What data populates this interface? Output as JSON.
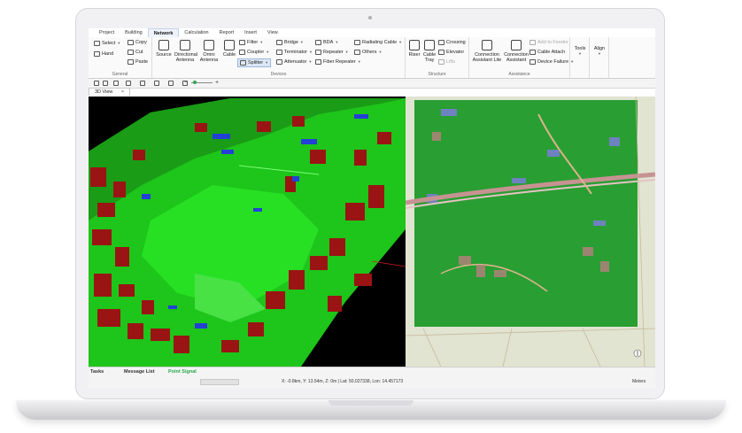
{
  "menu": {
    "tabs": [
      {
        "label": "Project"
      },
      {
        "label": "Building"
      },
      {
        "label": "Network"
      },
      {
        "label": "Calculation"
      },
      {
        "label": "Report"
      },
      {
        "label": "Insert"
      },
      {
        "label": "View"
      }
    ],
    "active_tab": "Network"
  },
  "ribbon": {
    "general": {
      "label": "General",
      "select": "Select",
      "hand": "Hand",
      "copy": "Copy",
      "cut": "Cut",
      "paste": "Paste"
    },
    "devices": {
      "label": "Devices",
      "source": "Source",
      "directional_antenna": "Directional Antenna",
      "omni_antenna": "Omni Antenna",
      "cable": "Cable",
      "filter": "Filter",
      "coupler": "Coupler",
      "splitter": "Splitter",
      "bridge": "Bridge",
      "terminator": "Terminator",
      "attenuator": "Attenuator",
      "bda": "BDA",
      "repeater": "Repeater",
      "fiber_repeater": "Fiber Repeater",
      "radiating_cable": "Radiating Cable",
      "others": "Others"
    },
    "structure": {
      "label": "Structure",
      "riser": "Riser",
      "cable_tray": "Cable Tray",
      "crossing": "Crossing",
      "elevator": "Elevator",
      "lifts": "Lifts"
    },
    "assistance": {
      "label": "Assistance",
      "connection_assistant_lite": "Connection Assistant Lite",
      "connection_assistant": "Connection Assistant",
      "add_to_feeder": "Add to Feeder",
      "cable_attach": "Cable Attach",
      "device_failure": "Device Failure"
    },
    "tools": "Tools",
    "align": "Align"
  },
  "document": {
    "tab_label": "3D View",
    "close_symbol": "×"
  },
  "status": {
    "tasks": "Tasks",
    "message_list": "Message List",
    "point_signal": "Point Signal",
    "coordinates": "X: -0.8km, Y: 13.54m, Z: 0m | Lat: 50.027338, Lon: 14.457173",
    "units": "Meters"
  },
  "colors": {
    "accent": "#2a6ebb",
    "terrain_green": "#22d11f",
    "building_red": "#9a1414",
    "water_blue": "#2340d6",
    "map_overlay": "#1f9a2a",
    "point_signal": "#27a84a"
  }
}
